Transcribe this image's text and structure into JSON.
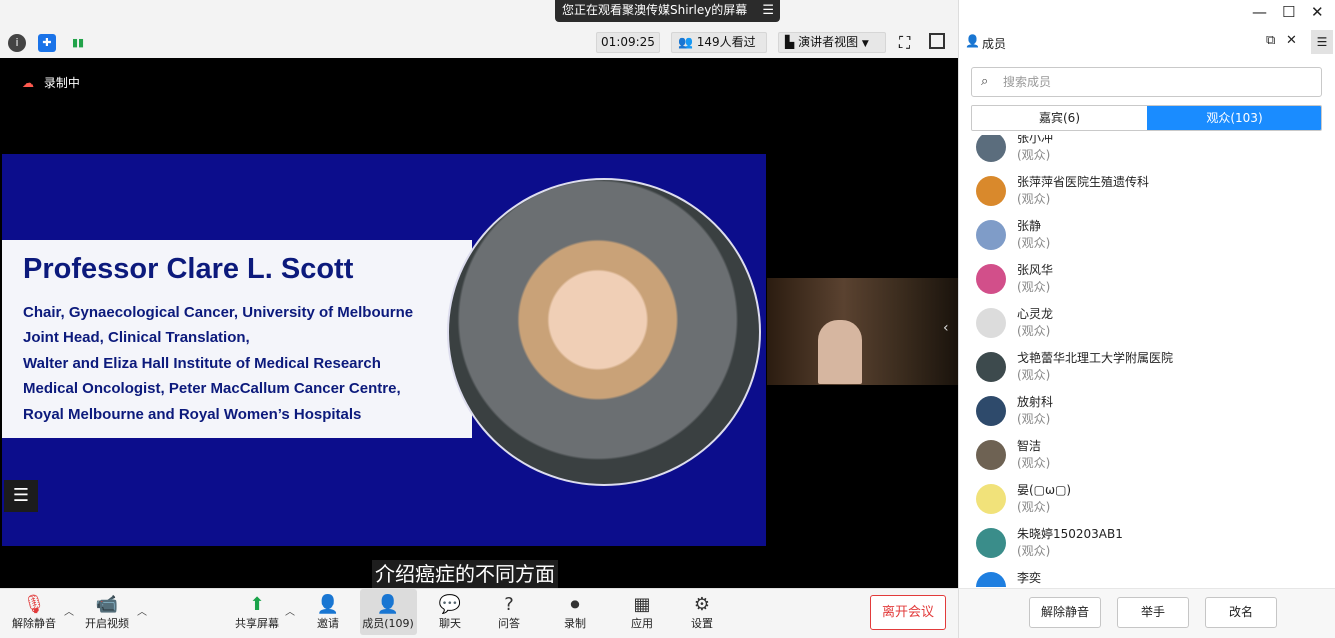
{
  "share_banner": {
    "text": "您正在观看聚澳传媒Shirley的屏幕",
    "menu_icon": "☰"
  },
  "top_bar": {
    "timer": "01:09:25",
    "viewers": "149人看过",
    "view_mode": "演讲者视图"
  },
  "video": {
    "recording_label": "录制中",
    "slide": {
      "name": "Professor Clare L. Scott",
      "lines": [
        "Chair, Gynaecological Cancer, University of Melbourne",
        "Joint Head, Clinical Translation,",
        "Walter and Eliza Hall Institute of Medical Research",
        "Medical Oncologist, Peter MacCallum Cancer Centre,",
        "Royal Melbourne and Royal Women’s Hospitals"
      ],
      "colors": {
        "panel": "#0c0d8c",
        "text": "#0c1a7c"
      }
    },
    "caption": "介绍癌症的不同方面"
  },
  "toolbar": {
    "unmute": "解除静音",
    "start_video": "开启视频",
    "share_screen": "共享屏幕",
    "invite": "邀请",
    "members": "成员(109)",
    "chat": "聊天",
    "qa": "问答",
    "record": "录制",
    "apps": "应用",
    "settings": "设置",
    "leave": "离开会议",
    "leave_color": "#e23b3b"
  },
  "panel": {
    "title": "成员",
    "search_placeholder": "搜索成员",
    "tabs": [
      {
        "label": "嘉宾(6)"
      },
      {
        "label": "观众(103)"
      }
    ],
    "active_tab_color": "#1a8cff",
    "members": [
      {
        "name": "张小冲",
        "role": "(观众)",
        "avatar": "#5b6d7d"
      },
      {
        "name": "张萍萍省医院生殖遗传科",
        "role": "(观众)",
        "avatar": "#d9892c"
      },
      {
        "name": "张静",
        "role": "(观众)",
        "avatar": "#7f9cc8"
      },
      {
        "name": "张风华",
        "role": "(观众)",
        "avatar": "#d24f8a"
      },
      {
        "name": "心灵龙",
        "role": "(观众)",
        "avatar": "#dcdcdc"
      },
      {
        "name": "戈艳蕾华北理工大学附属医院",
        "role": "(观众)",
        "avatar": "#3d4a4d"
      },
      {
        "name": "放射科",
        "role": "(观众)",
        "avatar": "#2e4a6b"
      },
      {
        "name": "智洁",
        "role": "(观众)",
        "avatar": "#6e6253"
      },
      {
        "name": "晏(▢ω▢)",
        "role": "(观众)",
        "avatar": "#f1e27a"
      },
      {
        "name": "朱晓婷150203AB1",
        "role": "(观众)",
        "avatar": "#3a8d8a"
      },
      {
        "name": "李奕",
        "role": "",
        "avatar": "#1f7fe0"
      }
    ],
    "buttons": {
      "unmute": "解除静音",
      "raise_hand": "举手",
      "rename": "改名"
    }
  }
}
